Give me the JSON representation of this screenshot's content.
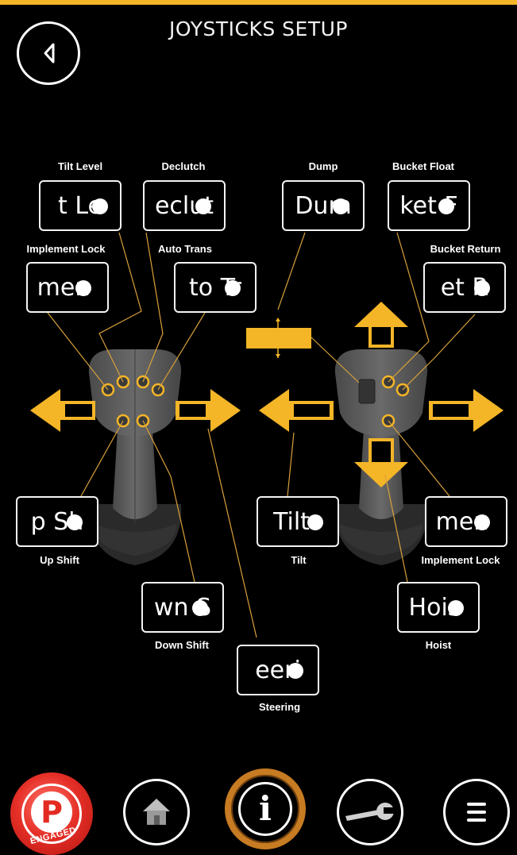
{
  "header": {
    "title": "JOYSTICKS SETUP"
  },
  "left_joystick": {
    "buttons": {
      "tilt_level": {
        "value": "t Le",
        "caption": "Tilt Level"
      },
      "declutch": {
        "value": "eclut",
        "caption": "Declutch"
      },
      "implement_lock": {
        "value": "men",
        "caption": "Implement Lock"
      },
      "auto_trans": {
        "value": "to Tr",
        "caption": "Auto Trans"
      },
      "up_shift": {
        "value": "p Sh",
        "caption": "Up Shift"
      },
      "down_shift": {
        "value": "wn S",
        "caption": "Down Shift"
      },
      "steering": {
        "value": "eeri",
        "caption": "Steering"
      }
    }
  },
  "right_joystick": {
    "buttons": {
      "dump": {
        "value": "Dum",
        "caption": "Dump"
      },
      "bucket_float": {
        "value": "ket F",
        "caption": "Bucket Float"
      },
      "bucket_return": {
        "value": "et R",
        "caption": "Bucket Return"
      },
      "tilt": {
        "value": "Tilt",
        "caption": "Tilt"
      },
      "implement_lock": {
        "value": "men",
        "caption": "Implement Lock"
      },
      "hoist": {
        "value": "Hois",
        "caption": "Hoist"
      }
    }
  },
  "bottom_nav": {
    "parking_brake": {
      "letter": "P",
      "status": "ENGAGED"
    },
    "info": {
      "glyph": "i"
    },
    "icons": [
      "home-icon",
      "info-icon",
      "wrench-icon",
      "menu-icon"
    ]
  },
  "colors": {
    "accent": "#f4b527",
    "background": "#000000",
    "joystick": "#5c5c5c"
  }
}
